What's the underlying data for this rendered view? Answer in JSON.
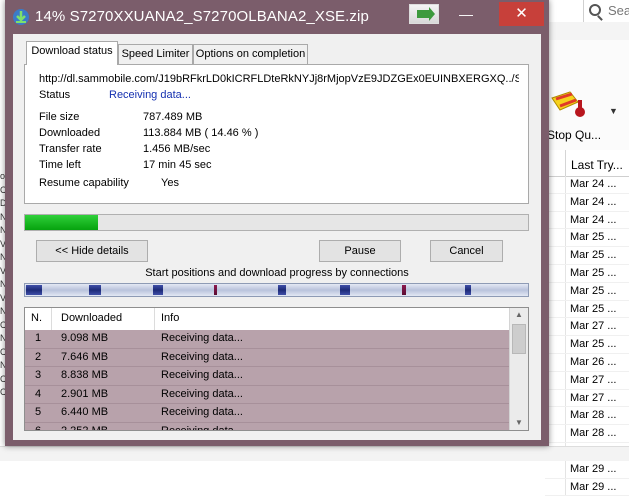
{
  "background_app": {
    "search_placeholder": "Sea",
    "toolbar_stop_label": "Stop Qu...",
    "last_try_header": "Last Try...",
    "last_try_dates": [
      "Mar 24 ...",
      "Mar 24 ...",
      "Mar 24 ...",
      "Mar 25 ...",
      "Mar 25 ...",
      "Mar 25 ...",
      "Mar 25 ...",
      "Mar 25 ...",
      "Mar 27 ...",
      "Mar 25 ...",
      "Mar 26 ...",
      "Mar 27 ...",
      "Mar 27 ...",
      "Mar 28 ...",
      "Mar 28 ...",
      "Mar 28 ...",
      "Mar 29 ...",
      "Mar 29 ..."
    ],
    "left_edge_letters": [
      "o",
      "C",
      "D",
      "N",
      "N",
      "V",
      "N",
      "V",
      "N",
      "V",
      "N",
      "C",
      "N",
      "C",
      "N",
      "C",
      "C"
    ]
  },
  "dialog": {
    "title": "14% S7270XXUANA2_S7270OLBANA2_XSE.zip",
    "tabs": [
      "Download status",
      "Speed Limiter",
      "Options on completion"
    ],
    "url": "http://dl.sammobile.com/J19bRFkrLD0kICRFLDteRkNYJj8rMjopVzE9JDZGEx0EUINBXERGXQ../S7",
    "status_label": "Status",
    "status_value": "Receiving data...",
    "fields": [
      {
        "label": "File size",
        "value": "787.489  MB"
      },
      {
        "label": "Downloaded",
        "value": "113.884  MB  ( 14.46 % )"
      },
      {
        "label": "Transfer rate",
        "value": "1.456  MB/sec"
      },
      {
        "label": "Time left",
        "value": "17 min 45 sec"
      }
    ],
    "resume_label": "Resume capability",
    "resume_value": "Yes",
    "progress_fraction": 0.1446,
    "buttons": {
      "hide_details": "<< Hide details",
      "pause": "Pause",
      "cancel": "Cancel"
    },
    "connections_title": "Start positions and download progress by connections",
    "connections_table": {
      "headers": [
        "N.",
        "Downloaded",
        "Info"
      ],
      "rows": [
        {
          "n": "1",
          "downloaded": "9.098  MB",
          "info": "Receiving data..."
        },
        {
          "n": "2",
          "downloaded": "7.646  MB",
          "info": "Receiving data..."
        },
        {
          "n": "3",
          "downloaded": "8.838  MB",
          "info": "Receiving data..."
        },
        {
          "n": "4",
          "downloaded": "2.901  MB",
          "info": "Receiving data..."
        },
        {
          "n": "5",
          "downloaded": "6.440  MB",
          "info": "Receiving data..."
        },
        {
          "n": "6",
          "downloaded": "2.252  MB",
          "info": "Receiving data..."
        }
      ]
    },
    "colors": {
      "titlebar": "#7b5d6b",
      "close": "#c7403a",
      "progress": "#06a20e",
      "status_link": "#1530b0"
    }
  }
}
